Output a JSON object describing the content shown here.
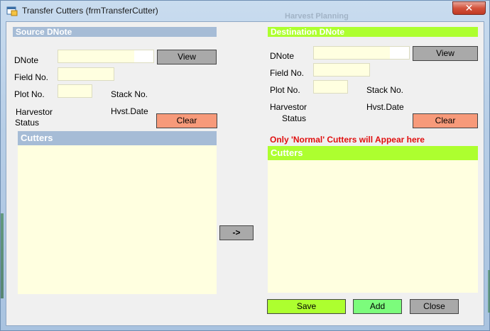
{
  "window": {
    "title": "Transfer Cutters (frmTransferCutter)",
    "close_label": "✕",
    "background_text": "Harvest Planning"
  },
  "source": {
    "header": "Source DNote",
    "dnote_label": "DNote",
    "field_label": "Field No.",
    "plot_label": "Plot No.",
    "stack_label": "Stack No.",
    "harvestor_label": "Harvestor",
    "status_label": "Status",
    "hvst_date_label": "Hvst.Date",
    "view_label": "View",
    "clear_label": "Clear",
    "cutters_header": "Cutters",
    "dnote_value": "",
    "field_value": "",
    "plot_value": ""
  },
  "destination": {
    "header": "Destination DNote",
    "dnote_label": "DNote",
    "field_label": "Field No.",
    "plot_label": "Plot No.",
    "stack_label": "Stack No.",
    "harvestor_label": "Harvestor",
    "status_label": "Status",
    "hvst_date_label": "Hvst.Date",
    "view_label": "View",
    "clear_label": "Clear",
    "note": "Only 'Normal' Cutters will Appear here",
    "cutters_header": "Cutters",
    "dnote_value": "",
    "field_value": "",
    "plot_value": ""
  },
  "transfer_label": "->",
  "footer": {
    "save_label": "Save",
    "add_label": "Add",
    "close_label": "Close"
  },
  "colors": {
    "source_header": "#a6bcd6",
    "destination_header": "#adff2f",
    "textbox_bg": "#ffffe0",
    "clear_button": "#f79a7a",
    "note_text": "#e01010"
  }
}
